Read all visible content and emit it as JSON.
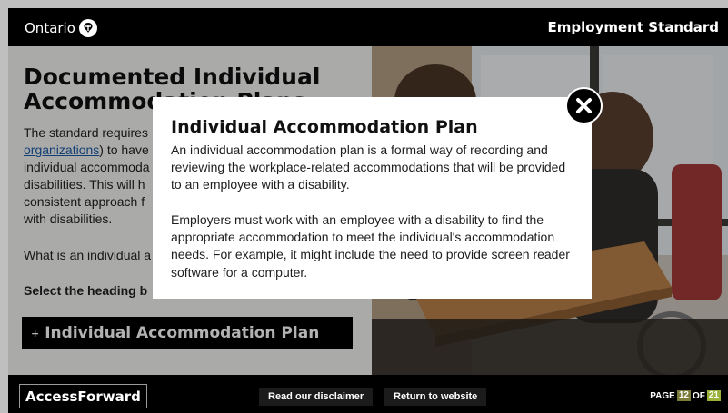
{
  "header": {
    "brand": "Ontario",
    "course_title": "Employment Standard"
  },
  "page": {
    "heading": "Documented Individual Accommodation Plans",
    "intro_prefix": "The standard requires",
    "intro_link": "organizations",
    "intro_lines": [
      ") to have",
      "individual accommoda",
      "disabilities. This will h",
      "consistent approach f",
      "with disabilities."
    ],
    "question": "What is an individual a",
    "select_label": "Select the heading b",
    "accordion_label": "Individual Accommodation Plan",
    "accordion_icon": "plus-icon"
  },
  "modal": {
    "title": "Individual Accommodation Plan",
    "paragraph1": "An individual accommodation plan is a formal way of recording and reviewing the workplace-related accommodations that will be provided to an employee with a disability.",
    "paragraph2": "Employers must work with an employee with a disability to find the appropriate accommodation to meet the individual's accommodation needs. For example, it might include the need to provide screen reader software for a computer.",
    "close_icon": "close-icon"
  },
  "footer": {
    "logo": "AccessForward",
    "disclaimer_button": "Read our disclaimer",
    "return_button": "Return to website",
    "page_label": "PAGE",
    "page_current": "12",
    "page_of": "OF",
    "page_total": "21"
  }
}
